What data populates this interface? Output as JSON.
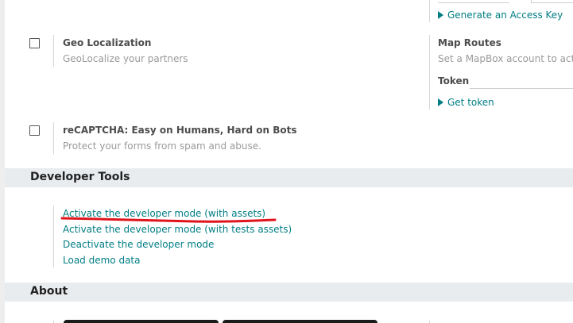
{
  "integrations": {
    "access_key_link": "Generate an Access Key",
    "geo": {
      "title": "Geo Localization",
      "description": "GeoLocalize your partners"
    },
    "map_routes": {
      "title": "Map Routes",
      "description": "Set a MapBox account to activ",
      "token_label": "Token",
      "token_value": "",
      "get_token_link": "Get token"
    },
    "recaptcha": {
      "title": "reCAPTCHA: Easy on Humans, Hard on Bots",
      "description": "Protect your forms from spam and abuse."
    }
  },
  "developer_tools": {
    "heading": "Developer Tools",
    "links": [
      "Activate the developer mode (with assets)",
      "Activate the developer mode (with tests assets)",
      "Deactivate the developer mode",
      "Load demo data"
    ]
  },
  "about": {
    "heading": "About"
  },
  "annotation": {
    "underline_color": "#e0141c"
  }
}
